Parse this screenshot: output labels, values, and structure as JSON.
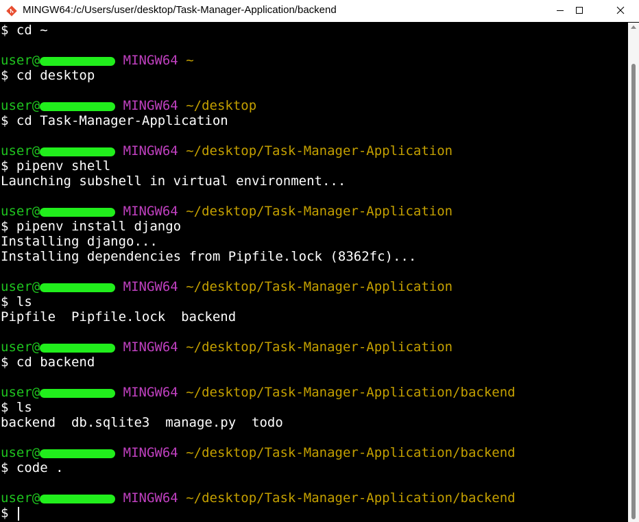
{
  "window": {
    "title": "MINGW64:/c/Users/user/desktop/Task-Manager-Application/backend",
    "controls": [
      "minimize",
      "maximize",
      "close"
    ]
  },
  "prompt": {
    "user": "user@",
    "host_redacted": true,
    "shell": "MINGW64",
    "symbol": "$"
  },
  "terminal_lines": [
    {
      "type": "cmd",
      "text": "$ cd ~"
    },
    {
      "type": "blank"
    },
    {
      "type": "prompt",
      "path": "~"
    },
    {
      "type": "cmd",
      "text": "$ cd desktop"
    },
    {
      "type": "blank"
    },
    {
      "type": "prompt",
      "path": "~/desktop"
    },
    {
      "type": "cmd",
      "text": "$ cd Task-Manager-Application"
    },
    {
      "type": "blank"
    },
    {
      "type": "prompt",
      "path": "~/desktop/Task-Manager-Application"
    },
    {
      "type": "cmd",
      "text": "$ pipenv shell"
    },
    {
      "type": "out",
      "text": "Launching subshell in virtual environment..."
    },
    {
      "type": "blank"
    },
    {
      "type": "prompt",
      "path": "~/desktop/Task-Manager-Application"
    },
    {
      "type": "cmd",
      "text": "$ pipenv install django"
    },
    {
      "type": "out",
      "text": "Installing django..."
    },
    {
      "type": "out",
      "text": "Installing dependencies from Pipfile.lock (8362fc)..."
    },
    {
      "type": "blank"
    },
    {
      "type": "prompt",
      "path": "~/desktop/Task-Manager-Application"
    },
    {
      "type": "cmd",
      "text": "$ ls"
    },
    {
      "type": "out",
      "text": "Pipfile  Pipfile.lock  backend"
    },
    {
      "type": "blank"
    },
    {
      "type": "prompt",
      "path": "~/desktop/Task-Manager-Application"
    },
    {
      "type": "cmd",
      "text": "$ cd backend"
    },
    {
      "type": "blank"
    },
    {
      "type": "prompt",
      "path": "~/desktop/Task-Manager-Application/backend"
    },
    {
      "type": "cmd",
      "text": "$ ls"
    },
    {
      "type": "out",
      "text": "backend  db.sqlite3  manage.py  todo"
    },
    {
      "type": "blank"
    },
    {
      "type": "prompt",
      "path": "~/desktop/Task-Manager-Application/backend"
    },
    {
      "type": "cmd",
      "text": "$ code ."
    },
    {
      "type": "blank"
    },
    {
      "type": "prompt",
      "path": "~/desktop/Task-Manager-Application/backend"
    },
    {
      "type": "input",
      "text": "$ "
    }
  ],
  "colors": {
    "background": "#000000",
    "text": "#ffffff",
    "user": "#1fc51f",
    "redaction": "#21ee1c",
    "shell": "#bf40bf",
    "path": "#c4a000",
    "titlebar": "#ffffff"
  },
  "icons": {
    "app": "git-bash-icon",
    "minimize": "minimize-icon",
    "maximize": "maximize-icon",
    "close": "close-icon"
  }
}
